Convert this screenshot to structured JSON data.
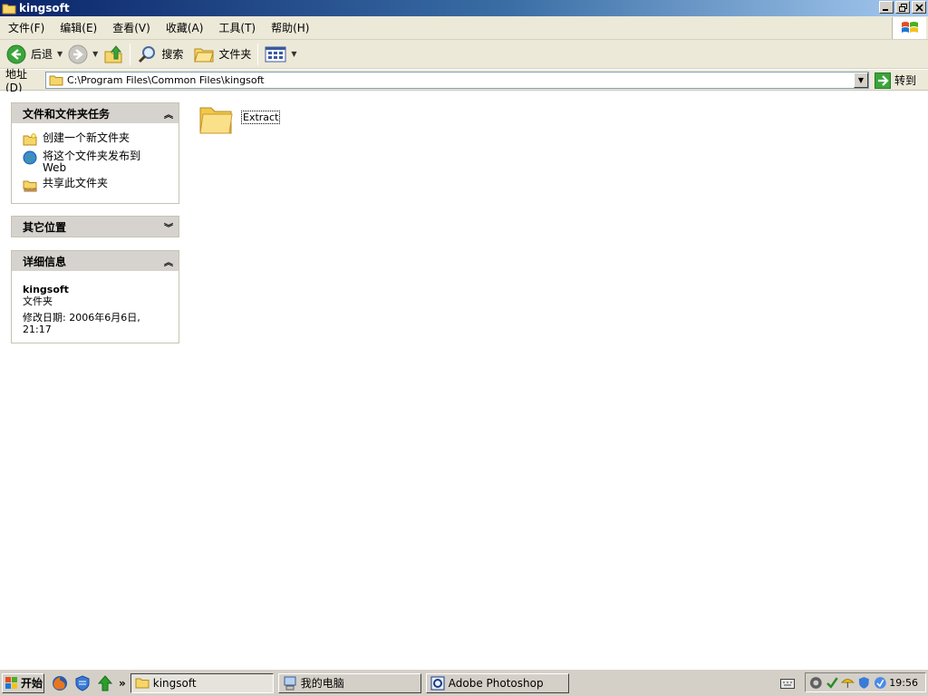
{
  "window": {
    "title": "kingsoft"
  },
  "menubar": {
    "items": [
      "文件(F)",
      "编辑(E)",
      "查看(V)",
      "收藏(A)",
      "工具(T)",
      "帮助(H)"
    ]
  },
  "toolbar": {
    "back_label": "后退",
    "search_label": "搜索",
    "folders_label": "文件夹"
  },
  "addressbar": {
    "label": "地址(D)",
    "value": "C:\\Program Files\\Common Files\\kingsoft",
    "go_label": "转到"
  },
  "sidebar": {
    "tasks": {
      "title": "文件和文件夹任务",
      "items": [
        {
          "label": "创建一个新文件夹",
          "icon": "new-folder-icon"
        },
        {
          "label": "将这个文件夹发布到 Web",
          "icon": "publish-web-icon"
        },
        {
          "label": "共享此文件夹",
          "icon": "share-folder-icon"
        }
      ]
    },
    "other_places": {
      "title": "其它位置"
    },
    "details": {
      "title": "详细信息",
      "name": "kingsoft",
      "type": "文件夹",
      "modified": "修改日期: 2006年6月6日, 21:17"
    }
  },
  "content": {
    "items": [
      {
        "name": "Extract",
        "icon": "folder-icon"
      }
    ]
  },
  "taskbar": {
    "start_label": "开始",
    "tasks": [
      {
        "label": "kingsoft",
        "active": true
      },
      {
        "label": "我的电脑",
        "active": false
      },
      {
        "label": "Adobe Photoshop",
        "active": false
      }
    ],
    "clock": "19:56"
  },
  "colors": {
    "titlebar_start": "#0a246a",
    "titlebar_end": "#a6caf0",
    "chrome_bg": "#ece9d8",
    "panel_header": "#d6d3ce"
  }
}
